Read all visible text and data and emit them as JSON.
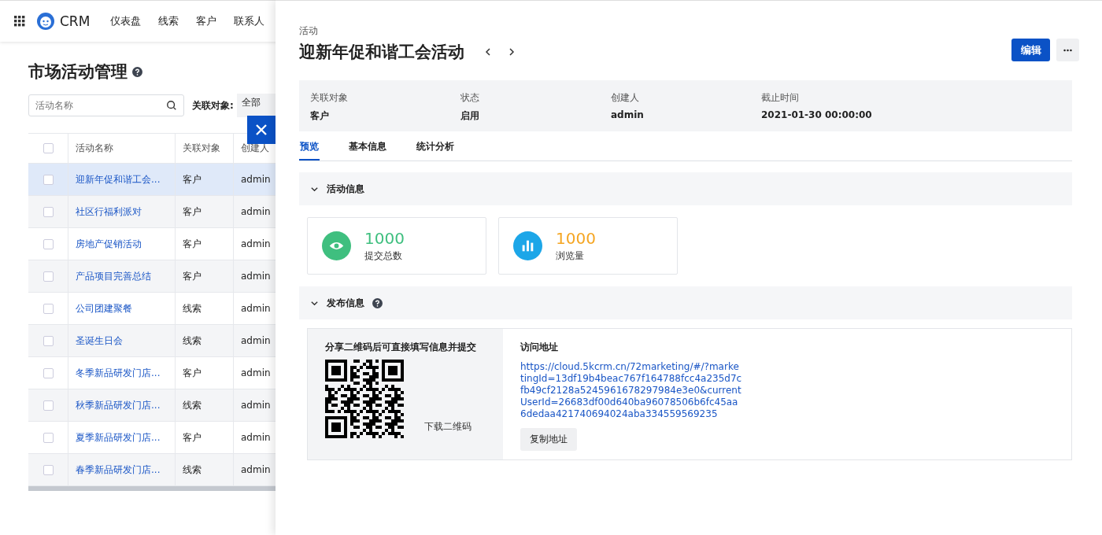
{
  "nav": {
    "logo": "CRM",
    "items": [
      "仪表盘",
      "线索",
      "客户",
      "联系人"
    ]
  },
  "page": {
    "title": "市场活动管理",
    "search": {
      "placeholder": "活动名称"
    },
    "filter": {
      "label": "关联对象:",
      "value": "全部"
    }
  },
  "table": {
    "select_all_checked": false,
    "columns": [
      "活动名称",
      "关联对象",
      "创建人"
    ],
    "rows": [
      {
        "name": "迎新年促和谐工会...",
        "type": "客户",
        "creator": "admin",
        "selected": true
      },
      {
        "name": "社区行福利派对",
        "type": "客户",
        "creator": "admin",
        "selected": false
      },
      {
        "name": "房地产促销活动",
        "type": "客户",
        "creator": "admin",
        "selected": false
      },
      {
        "name": "产品项目完善总结",
        "type": "客户",
        "creator": "admin",
        "selected": false
      },
      {
        "name": "公司团建聚餐",
        "type": "线索",
        "creator": "admin",
        "selected": false
      },
      {
        "name": "圣诞生日会",
        "type": "线索",
        "creator": "admin",
        "selected": false
      },
      {
        "name": "冬季新品研发门店...",
        "type": "客户",
        "creator": "admin",
        "selected": false
      },
      {
        "name": "秋季新品研发门店...",
        "type": "线索",
        "creator": "admin",
        "selected": false
      },
      {
        "name": "夏季新品研发门店...",
        "type": "客户",
        "creator": "admin",
        "selected": false
      },
      {
        "name": "春季新品研发门店...",
        "type": "线索",
        "creator": "admin",
        "selected": false
      }
    ]
  },
  "drawer": {
    "caption": "活动",
    "title": "迎新年促和谐工会活动",
    "edit_button": "编辑",
    "fields": [
      {
        "label": "关联对象",
        "value": "客户"
      },
      {
        "label": "状态",
        "value": "启用"
      },
      {
        "label": "创建人",
        "value": "admin"
      },
      {
        "label": "截止时间",
        "value": "2021-01-30 00:00:00"
      }
    ],
    "tabs": [
      {
        "label": "预览",
        "selected": true
      },
      {
        "label": "基本信息",
        "selected": false
      },
      {
        "label": "统计分析",
        "selected": false
      }
    ],
    "section_activity": {
      "title": "活动信息",
      "stats": [
        {
          "kind": "eye",
          "value": "1000",
          "label": "提交总数",
          "color": "#3fbf7f"
        },
        {
          "kind": "chart",
          "value": "1000",
          "label": "浏览量",
          "color": "#f5a623"
        }
      ]
    },
    "section_publish": {
      "title": "发布信息",
      "qr_caption": "分享二维码后可直接填写信息并提交",
      "download": "下载二维码",
      "url_label": "访问地址",
      "url": "https://cloud.5kcrm.cn/72marketing/#/?marketingId=13df19b4beac767f164788fcc4a235d7cfb49cf2128a5245961678297984e3e0&currentUserId=26683df00d640ba96078506b6fc45aa6dedaa421740694024aba334559569235",
      "copy_button": "复制地址"
    }
  }
}
